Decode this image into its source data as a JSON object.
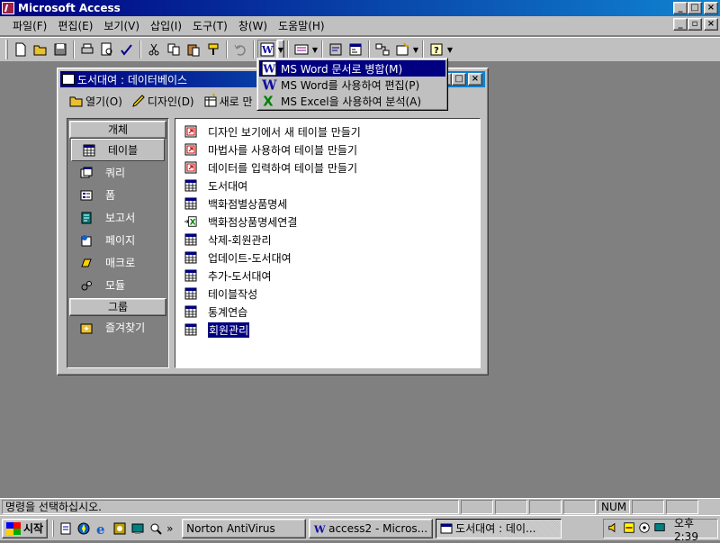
{
  "window": {
    "title": "Microsoft Access",
    "min": "_",
    "max": "□",
    "close": "×"
  },
  "menu": [
    "파일(F)",
    "편집(E)",
    "보기(V)",
    "삽입(I)",
    "도구(T)",
    "창(W)",
    "도움말(H)"
  ],
  "mdi_controls": {
    "min": "_",
    "max": "▫",
    "close": "×"
  },
  "office_links_menu": [
    {
      "label": "MS Word 문서로 병합(M)",
      "icon": "word-merge-icon",
      "selected": true
    },
    {
      "label": "MS Word를 사용하여 편집(P)",
      "icon": "word-icon",
      "selected": false
    },
    {
      "label": "MS Excel을 사용하여 분석(A)",
      "icon": "excel-icon",
      "selected": false
    }
  ],
  "dbwindow": {
    "title": "도서대여 : 데이터베이스",
    "toolbar": {
      "open": "열기(O)",
      "design": "디자인(D)",
      "new": "새로 만"
    },
    "objects_header": "개체",
    "objects": [
      {
        "label": "테이블",
        "icon": "table-icon",
        "selected": true
      },
      {
        "label": "쿼리",
        "icon": "query-icon",
        "selected": false
      },
      {
        "label": "폼",
        "icon": "form-icon",
        "selected": false
      },
      {
        "label": "보고서",
        "icon": "report-icon",
        "selected": false
      },
      {
        "label": "페이지",
        "icon": "page-icon",
        "selected": false
      },
      {
        "label": "매크로",
        "icon": "macro-icon",
        "selected": false
      },
      {
        "label": "모듈",
        "icon": "module-icon",
        "selected": false
      }
    ],
    "groups_header": "그룹",
    "groups": [
      {
        "label": "즐겨찾기",
        "icon": "favorites-icon"
      }
    ],
    "items": [
      {
        "label": "디자인 보기에서 새 테이블 만들기",
        "icon": "shortcut-icon",
        "selected": false
      },
      {
        "label": "마법사를 사용하여 테이블 만들기",
        "icon": "shortcut-icon",
        "selected": false
      },
      {
        "label": "데이터를 입력하여 테이블 만들기",
        "icon": "shortcut-icon",
        "selected": false
      },
      {
        "label": "도서대여",
        "icon": "table-icon",
        "selected": false
      },
      {
        "label": "백화점별상품명세",
        "icon": "table-icon",
        "selected": false
      },
      {
        "label": "백화점상품명세연결",
        "icon": "linked-excel-icon",
        "selected": false
      },
      {
        "label": "삭제-회원관리",
        "icon": "table-icon",
        "selected": false
      },
      {
        "label": "업데이트-도서대여",
        "icon": "table-icon",
        "selected": false
      },
      {
        "label": "추가-도서대여",
        "icon": "table-icon",
        "selected": false
      },
      {
        "label": "테이블작성",
        "icon": "table-icon",
        "selected": false
      },
      {
        "label": "통계연습",
        "icon": "table-icon",
        "selected": false
      },
      {
        "label": "회원관리",
        "icon": "table-icon",
        "selected": true
      }
    ]
  },
  "status": {
    "message": "명령을 선택하십시오.",
    "num": "NUM"
  },
  "taskbar": {
    "start": "시작",
    "more": "»",
    "tasks": [
      {
        "label": "Norton AntiVirus",
        "icon": "",
        "active": false
      },
      {
        "label": "access2 - Micros...",
        "icon": "word-icon",
        "active": false
      },
      {
        "label": "도서대여 : 데이...",
        "icon": "db-icon",
        "active": true
      }
    ],
    "clock": "오후 2:39"
  }
}
